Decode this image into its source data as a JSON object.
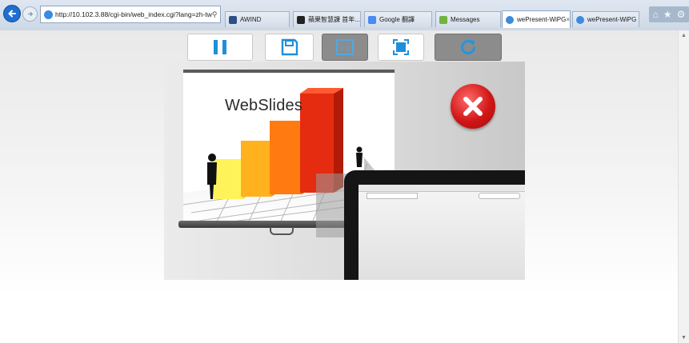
{
  "browser": {
    "address": "http://10.102.3.88/cgi-bin/web_index.cgi?lang=zh-tw",
    "address_host": "10.102.3.88",
    "tabs": [
      {
        "label": "AWIND",
        "fav_color": "#2e4f86"
      },
      {
        "label": "蘋果智慧課 首年...",
        "fav_color": "#222222"
      },
      {
        "label": "Google 翻譯",
        "fav_color": "#4a8af4"
      },
      {
        "label": "Messages",
        "fav_color": "#6fb43f"
      },
      {
        "label": "wePresent-WiPG",
        "fav_color": "#3b8be0",
        "active": true
      },
      {
        "label": "wePresent-WiPG",
        "fav_color": "#3b8be0"
      }
    ],
    "close_glyph": "×",
    "right_icons": [
      "home-icon",
      "star-icon",
      "gear-icon"
    ]
  },
  "toolbar": {
    "buttons": [
      {
        "name": "pause-icon",
        "state": "active",
        "color": "#1f8fd8"
      },
      {
        "name": "save-icon",
        "state": "active",
        "color": "#1f8fd8"
      },
      {
        "name": "actual-size-icon",
        "state": "selected",
        "color": "#1f8fd8"
      },
      {
        "name": "fullscreen-icon",
        "state": "active",
        "color": "#1f8fd8"
      },
      {
        "name": "refresh-icon",
        "state": "disabled",
        "color": "#1f8fd8"
      }
    ]
  },
  "stage": {
    "slide_title": "WebSlides",
    "bars": [
      "#fff35a",
      "#ffb21e",
      "#ff7a10",
      "#e52b10"
    ],
    "close_badge_color": "#d11616"
  }
}
